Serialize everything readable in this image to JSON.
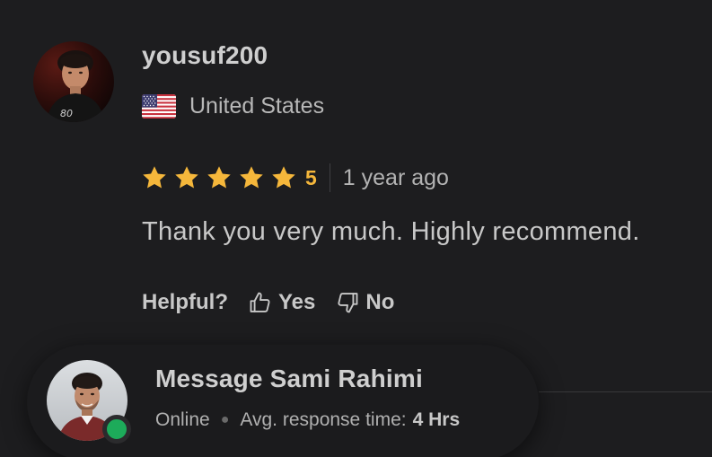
{
  "review": {
    "username": "yousuf200",
    "country": "United States",
    "country_flag_icon": "us-flag-icon",
    "rating": "5",
    "rating_value": 5,
    "rating_max": 5,
    "time_ago": "1 year ago",
    "text": "Thank you very much. Highly recommend.",
    "helpful_label": "Helpful?",
    "yes_label": "Yes",
    "no_label": "No"
  },
  "seller": {
    "message_label": "Message Sami Rahimi",
    "status": "Online",
    "response_label": "Avg. response time:",
    "response_value": "4 Hrs"
  },
  "colors": {
    "background": "#1d1d1f",
    "star": "#f5b73b",
    "online": "#1dab5a",
    "text": "#c8c8c8"
  }
}
